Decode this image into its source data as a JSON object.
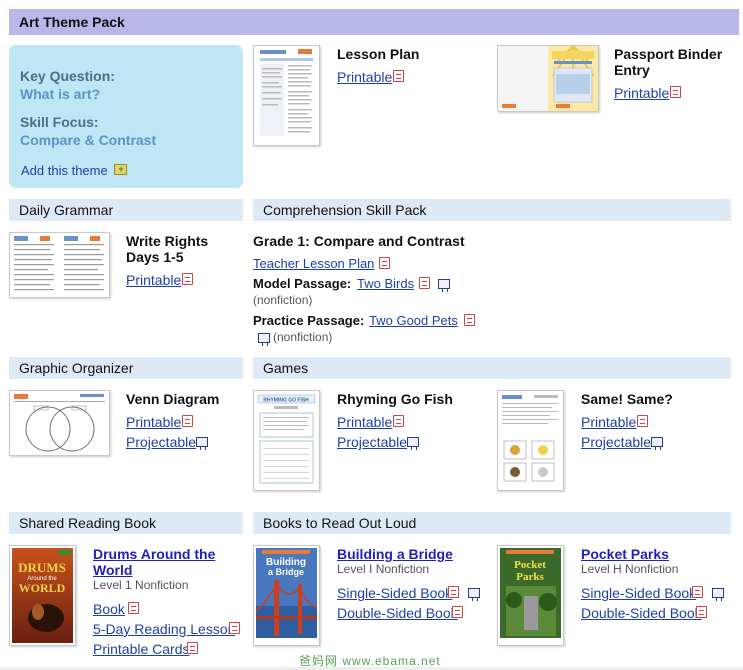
{
  "header": {
    "title": "Art Theme Pack"
  },
  "key_box": {
    "question_label": "Key Question:",
    "question_value": "What is art?",
    "skill_label": "Skill Focus:",
    "skill_value": "Compare & Contrast",
    "add_label": "Add this theme"
  },
  "lesson_plan": {
    "title": "Lesson Plan",
    "printable": "Printable"
  },
  "passport": {
    "title_line1": "Passport Binder",
    "title_line2": "Entry",
    "printable": "Printable"
  },
  "sections": {
    "daily_grammar": "Daily Grammar",
    "comprehension": "Comprehension Skill Pack",
    "graphic_organizer": "Graphic Organizer",
    "games": "Games",
    "shared_reading": "Shared Reading Book",
    "books_aloud": "Books to Read Out Loud"
  },
  "write_rights": {
    "title_line1": "Write Rights",
    "title_line2": "Days 1-5",
    "printable": "Printable"
  },
  "comprehension": {
    "title": "Grade 1: Compare and Contrast",
    "teacher_link": "Teacher Lesson Plan",
    "model_label": "Model Passage:",
    "model_link": "Two Birds",
    "model_type": "(nonfiction)",
    "practice_label": "Practice Passage:",
    "practice_link": "Two Good Pets",
    "practice_type": "(nonfiction)"
  },
  "venn": {
    "title": "Venn Diagram",
    "printable": "Printable",
    "projectable": "Projectable"
  },
  "rhyming": {
    "title": "Rhyming Go Fish",
    "printable": "Printable",
    "projectable": "Projectable",
    "thumb_title": "RHYMING GO FISH"
  },
  "same": {
    "title": "Same! Same?",
    "printable": "Printable",
    "projectable": "Projectable"
  },
  "drums": {
    "title_line1": "Drums Around the",
    "title_line2": "World",
    "level": "Level 1 Nonfiction",
    "book": "Book",
    "five_day": "5-Day Reading Lesson",
    "cards": "Printable Cards",
    "cover_line1": "DRUMS",
    "cover_line2": "Around the",
    "cover_line3": "WORLD"
  },
  "bridge": {
    "title": "Building a Bridge",
    "level": "Level I Nonfiction",
    "single": "Single-Sided Book",
    "double": "Double-Sided Book",
    "cover_line1": "Building",
    "cover_line2": "a Bridge"
  },
  "parks": {
    "title": "Pocket Parks",
    "level": "Level H Nonfiction",
    "single": "Single-Sided Book",
    "double": "Double-Sided Book",
    "cover_line1": "Pocket",
    "cover_line2": "Parks"
  },
  "watermark": "爸妈网 www.ebama.net"
}
